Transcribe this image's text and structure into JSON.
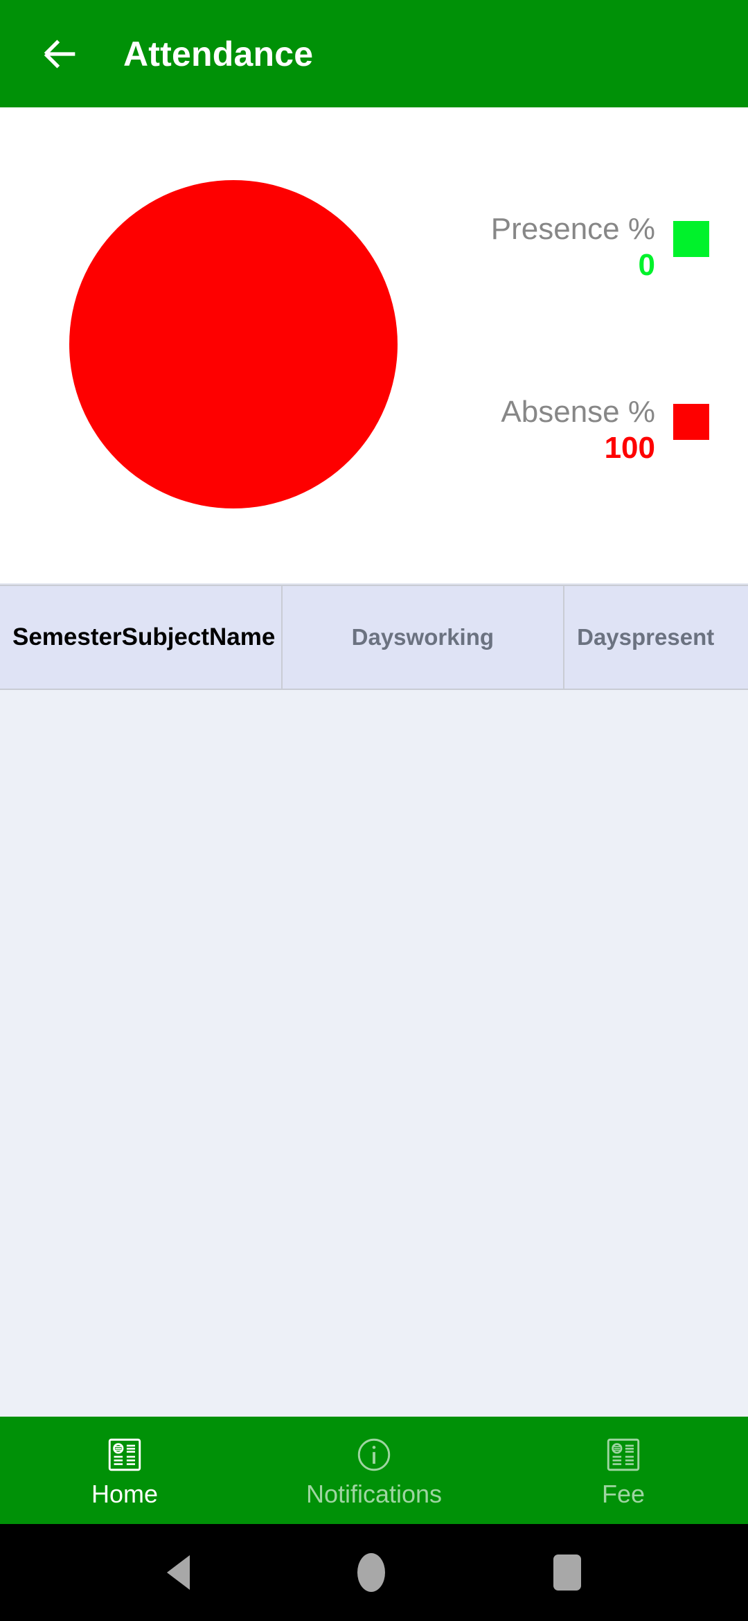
{
  "appbar": {
    "title": "Attendance",
    "back_icon": "arrow-left-icon",
    "background_color": "#009107",
    "title_color": "#ffffff"
  },
  "chart_data": {
    "type": "pie",
    "title": "",
    "categories": [
      "Presence %",
      "Absense %"
    ],
    "values": [
      0,
      100
    ],
    "colors": [
      "#00f22b",
      "#fe0000"
    ],
    "legend_position": "right",
    "legend": [
      {
        "label": "Presence %",
        "value": "0",
        "color": "#00f22b",
        "label_color": "#878787"
      },
      {
        "label": "Absense %",
        "value": "100",
        "color": "#fe0000",
        "label_color": "#878787"
      }
    ],
    "slices": [
      {
        "name": "Presence %",
        "percent": 0,
        "color": "#00f22b"
      },
      {
        "name": "Absense %",
        "percent": 100,
        "color": "#fe0000"
      }
    ]
  },
  "table": {
    "columns": [
      {
        "header": "SemesterSubjectName",
        "align": "left"
      },
      {
        "header": "Daysworking",
        "align": "center"
      },
      {
        "header": "Dayspresent",
        "align": "left"
      }
    ],
    "rows": [],
    "header_background": "#dfe3f5",
    "body_background": "#edf0f7"
  },
  "bottom_nav": {
    "background_color": "#009107",
    "items": [
      {
        "label": "Home",
        "icon": "article-icon",
        "selected": true
      },
      {
        "label": "Notifications",
        "icon": "info-circle-icon",
        "selected": false
      },
      {
        "label": "Fee",
        "icon": "article-icon",
        "selected": false
      }
    ]
  },
  "system_nav": {
    "back": "triangle-back-icon",
    "home": "circle-home-icon",
    "recents": "square-recents-icon"
  }
}
